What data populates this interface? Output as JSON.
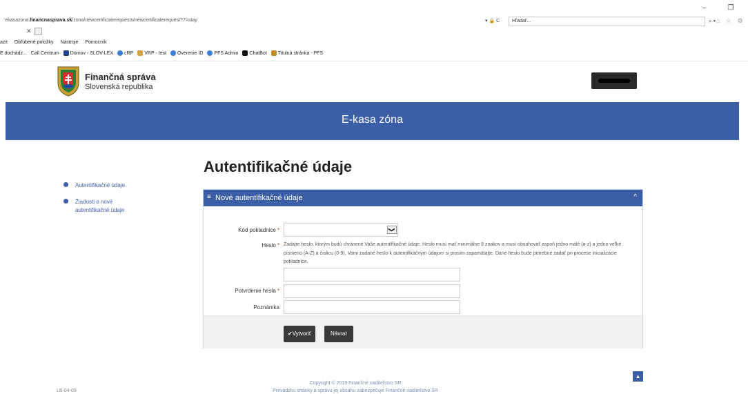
{
  "browser": {
    "url_prefix": "'",
    "url_host_pre": "ekasazona.",
    "url_host_bold": "financnasprava.sk",
    "url_path": "/zona/newcertificaterequests/newcertificaterequest?7=stay",
    "addr_controls": "▾ 🔒 C",
    "search_placeholder": "Hľadať...",
    "search_glyph": "⌕ ▾",
    "window_controls": "– ❐ ✕",
    "tool_icons": "⌂ ☆ ⚙ ☺",
    "tab_close": "✕",
    "menu": [
      "Obľúbené položky",
      "Nástroje",
      "Pomocník"
    ],
    "menu_fragment": "azit",
    "favorites_fragment": "E dochádz...",
    "favorites": [
      {
        "label": "Call Centrum",
        "color": ""
      },
      {
        "label": "Domov - SLOV-LEX",
        "color": "#1f3f8c"
      },
      {
        "label": "cRP",
        "color": "#3d7fd6"
      },
      {
        "label": "VRP - test",
        "color": "#d6a23d"
      },
      {
        "label": "Overenie ID",
        "color": "#3d7fd6"
      },
      {
        "label": "PFS Admin",
        "color": "#3d7fd6"
      },
      {
        "label": "ChatBot",
        "color": "#111"
      },
      {
        "label": "Titulná stránka - PFS",
        "color": "#c78a1e"
      }
    ]
  },
  "header": {
    "brand_title": "Finančná správa",
    "brand_subtitle": "Slovenská republika",
    "banner_title": "E-kasa zóna",
    "accent_color": "#3b5ea6"
  },
  "sidebar": {
    "items": [
      {
        "label": "Autentifikačné údaje"
      },
      {
        "label": "Žiadosti o nové autentifikačné údaje"
      }
    ]
  },
  "main": {
    "title": "Autentifikačné údaje",
    "panel": {
      "title": "Nové autentifikačné údaje",
      "menu_glyph": "≡",
      "collapse_glyph": "^",
      "fields": {
        "cash_register": {
          "label": "Kód pokladnice",
          "value": ""
        },
        "password": {
          "label": "Heslo",
          "value": "",
          "help": "Zadajte heslo, ktorým budú chránené Vaše autentifikačné údaje. Heslo musí mať minimálne 8 znakov a musí obsahovať aspoň jedno malé (a-z) a jedno veľké písmeno (A-Z) a číslicu (0-9). Vami zadané heslo k autentifikačným údajom si prosím zapamätajte. Dané heslo bude potrebné zadať pri procese inicializácie pokladnice."
        },
        "password_confirm": {
          "label": "Potvrdenie hesla",
          "value": ""
        },
        "note": {
          "label": "Poznámka",
          "value": ""
        }
      },
      "required_marker": "*",
      "select_arrow": "❯",
      "create_label": "Vytvoriť",
      "create_icon": "✔",
      "back_label": "Návrat"
    }
  },
  "footer": {
    "version": "LB-04-09",
    "copyright": "Copyright © 2019 Finančné riaditeľstvo SR",
    "operator": "Prevádzku stránky a správu jej obsahu zabezpečuje Finančné riaditeľstvo SR",
    "scroll_top_glyph": "▲"
  }
}
